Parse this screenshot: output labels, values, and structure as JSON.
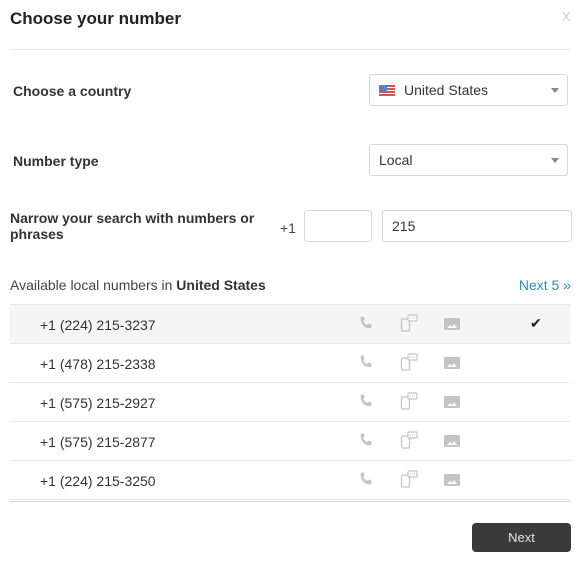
{
  "dialog": {
    "title": "Choose your number",
    "close_label": "X"
  },
  "country": {
    "label": "Choose a country",
    "selected": "United States",
    "flag_icon": "us-flag-icon"
  },
  "number_type": {
    "label": "Number type",
    "selected": "Local"
  },
  "search": {
    "label": "Narrow your search with numbers or phrases",
    "country_code": "+1",
    "area_code_value": "",
    "query_value": "215"
  },
  "results": {
    "heading_prefix": "Available local numbers in ",
    "heading_country": "United States",
    "next_link": "Next 5 »",
    "items": [
      {
        "number": "+1 (224) 215-3237",
        "selected": true
      },
      {
        "number": "+1 (478) 215-2338",
        "selected": false
      },
      {
        "number": "+1 (575) 215-2927",
        "selected": false
      },
      {
        "number": "+1 (575) 215-2877",
        "selected": false
      },
      {
        "number": "+1 (224) 215-3250",
        "selected": false
      }
    ],
    "capability_icons": [
      "phone-icon",
      "sms-icon",
      "mms-icon"
    ],
    "check_glyph": "✔"
  },
  "footer": {
    "next_button": "Next"
  },
  "colors": {
    "accent_link": "#2a8fbd",
    "button_bg": "#3a3a3a"
  }
}
